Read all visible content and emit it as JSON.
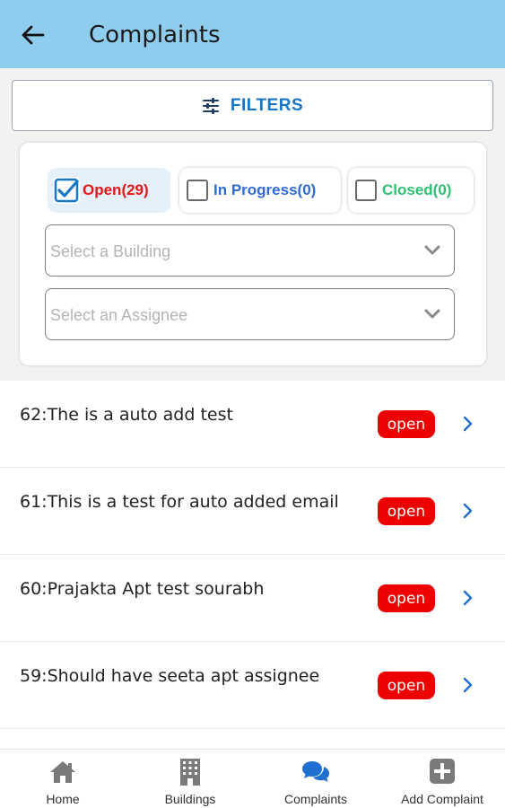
{
  "header": {
    "title": "Complaints"
  },
  "filters": {
    "label": "FILTERS"
  },
  "status_chips": {
    "open": {
      "label": "Open(29)",
      "checked": true
    },
    "in_progress": {
      "label": "In Progress(0)",
      "checked": false
    },
    "closed": {
      "label": "Closed(0)",
      "checked": false
    }
  },
  "selects": {
    "building": {
      "placeholder": "Select a Building"
    },
    "assignee": {
      "placeholder": "Select an Assignee"
    }
  },
  "complaints": [
    {
      "text": "62:The is a auto add test",
      "status": "open"
    },
    {
      "text": "61:This is a test for auto added email",
      "status": "open"
    },
    {
      "text": "60:Prajakta Apt test sourabh",
      "status": "open"
    },
    {
      "text": "59:Should have seeta apt assignee",
      "status": "open"
    }
  ],
  "tabs": {
    "home": "Home",
    "buildings": "Buildings",
    "complaints": "Complaints",
    "add_complaint": "Add Complaint"
  },
  "colors": {
    "appbar": "#8fcdef",
    "accent_blue": "#1677c9",
    "open_red": "#e51616",
    "badge_red": "#ee0000",
    "progress_blue": "#2f6bd8",
    "closed_green": "#2fbf71"
  }
}
